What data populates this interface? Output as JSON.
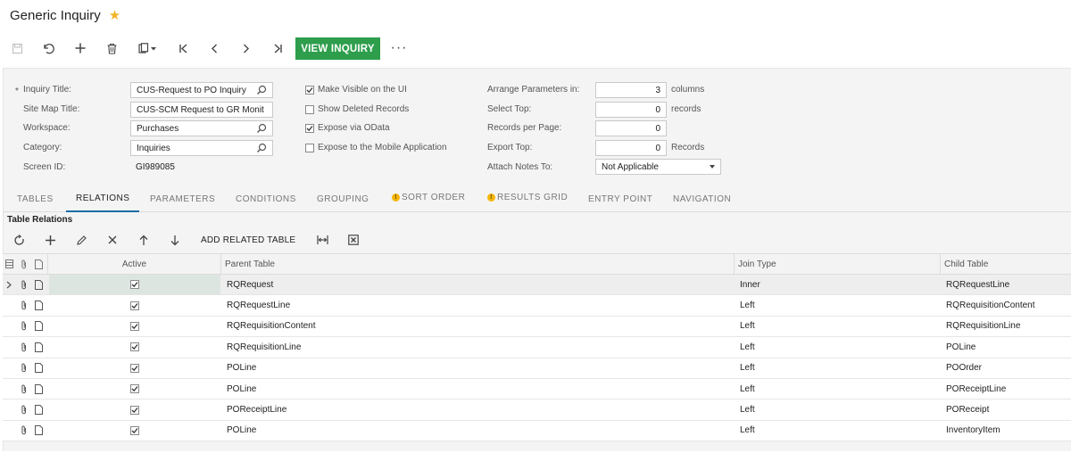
{
  "header": {
    "title": "Generic Inquiry",
    "favorite_icon": "star-icon",
    "toolbar": {
      "buttons": [
        "save-icon",
        "undo-icon",
        "add-icon",
        "delete-icon",
        "copy-paste-icon",
        "first-record-icon",
        "previous-record-icon",
        "next-record-icon",
        "last-record-icon"
      ],
      "primary_action": "VIEW INQUIRY",
      "more": "···"
    }
  },
  "form": {
    "inquiry_title": {
      "label": "Inquiry Title:",
      "value": "CUS-Request to PO Inquiry",
      "required_mark": "*"
    },
    "site_map_title": {
      "label": "Site Map Title:",
      "value": "CUS-SCM Request to GR Monit"
    },
    "workspace": {
      "label": "Workspace:",
      "value": "Purchases"
    },
    "category": {
      "label": "Category:",
      "value": "Inquiries"
    },
    "screen_id": {
      "label": "Screen ID:",
      "value": "GI989085"
    },
    "checkboxes": {
      "make_visible": {
        "label": "Make Visible on the UI",
        "checked": true
      },
      "show_deleted": {
        "label": "Show Deleted Records",
        "checked": false
      },
      "expose_odata": {
        "label": "Expose via OData",
        "checked": true
      },
      "expose_mobile": {
        "label": "Expose to the Mobile Application",
        "checked": false
      }
    },
    "arrange_parameters": {
      "label": "Arrange Parameters in:",
      "value": "3",
      "unit": "columns"
    },
    "select_top": {
      "label": "Select Top:",
      "value": "0",
      "unit": "records"
    },
    "records_per_page": {
      "label": "Records per Page:",
      "value": "0"
    },
    "export_top": {
      "label": "Export Top:",
      "value": "0",
      "unit": "Records"
    },
    "attach_notes": {
      "label": "Attach Notes To:",
      "value": "Not Applicable"
    }
  },
  "tabs": [
    {
      "label": "TABLES",
      "active": false,
      "warning": false
    },
    {
      "label": "RELATIONS",
      "active": true,
      "warning": false
    },
    {
      "label": "PARAMETERS",
      "active": false,
      "warning": false
    },
    {
      "label": "CONDITIONS",
      "active": false,
      "warning": false
    },
    {
      "label": "GROUPING",
      "active": false,
      "warning": false
    },
    {
      "label": "SORT ORDER",
      "active": false,
      "warning": true
    },
    {
      "label": "RESULTS GRID",
      "active": false,
      "warning": true
    },
    {
      "label": "ENTRY POINT",
      "active": false,
      "warning": false
    },
    {
      "label": "NAVIGATION",
      "active": false,
      "warning": false
    }
  ],
  "relations": {
    "title": "Table Relations",
    "toolbar": {
      "icons": [
        "refresh-icon",
        "add-row-icon",
        "edit-icon",
        "delete-row-icon",
        "move-up-icon",
        "move-down-icon"
      ],
      "add_related_table": "ADD RELATED TABLE",
      "extra_icons": [
        "fit-columns-icon",
        "export-excel-icon"
      ]
    },
    "columns": [
      "Active",
      "Parent Table",
      "Join Type",
      "Child Table"
    ],
    "rows": [
      {
        "active": true,
        "parent": "RQRequest",
        "join": "Inner",
        "child": "RQRequestLine",
        "selected": true
      },
      {
        "active": true,
        "parent": "RQRequestLine",
        "join": "Left",
        "child": "RQRequisitionContent",
        "selected": false
      },
      {
        "active": true,
        "parent": "RQRequisitionContent",
        "join": "Left",
        "child": "RQRequisitionLine",
        "selected": false
      },
      {
        "active": true,
        "parent": "RQRequisitionLine",
        "join": "Left",
        "child": "POLine",
        "selected": false
      },
      {
        "active": true,
        "parent": "POLine",
        "join": "Left",
        "child": "POOrder",
        "selected": false
      },
      {
        "active": true,
        "parent": "POLine",
        "join": "Left",
        "child": "POReceiptLine",
        "selected": false
      },
      {
        "active": true,
        "parent": "POReceiptLine",
        "join": "Left",
        "child": "POReceipt",
        "selected": false
      },
      {
        "active": true,
        "parent": "POLine",
        "join": "Left",
        "child": "InventoryItem",
        "selected": false
      }
    ]
  },
  "colors": {
    "primary_action": "#2e9e4c",
    "active_tab_underline": "#1b6ea5",
    "warning": "#f5b70a",
    "favorite": "#f0b429"
  }
}
